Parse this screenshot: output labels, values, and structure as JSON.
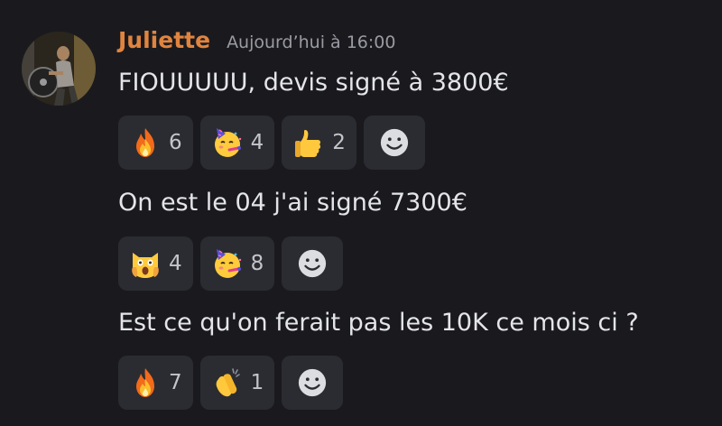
{
  "message": {
    "author": "Juliette",
    "timestamp": "Aujourd’hui à 16:00",
    "author_color": "#e0843f"
  },
  "messages": [
    {
      "text": "FIOUUUUU, devis signé à 3800€",
      "reactions": [
        {
          "icon": "fire-emoji-icon",
          "count": "6"
        },
        {
          "icon": "partying-face-emoji-icon",
          "count": "4"
        },
        {
          "icon": "thumbs-up-emoji-icon",
          "count": "2"
        }
      ]
    },
    {
      "text": "On est le 04 j'ai signé 7300€",
      "reactions": [
        {
          "icon": "screaming-cat-emoji-icon",
          "count": "4"
        },
        {
          "icon": "partying-face-emoji-icon",
          "count": "8"
        }
      ]
    },
    {
      "text": "Est ce qu'on ferait pas les 10K ce mois ci ?",
      "reactions": [
        {
          "icon": "fire-emoji-icon",
          "count": "7"
        },
        {
          "icon": "clapping-hands-emoji-icon",
          "count": "1"
        }
      ]
    }
  ],
  "add_reaction_icon": "smiley-add-reaction-icon"
}
